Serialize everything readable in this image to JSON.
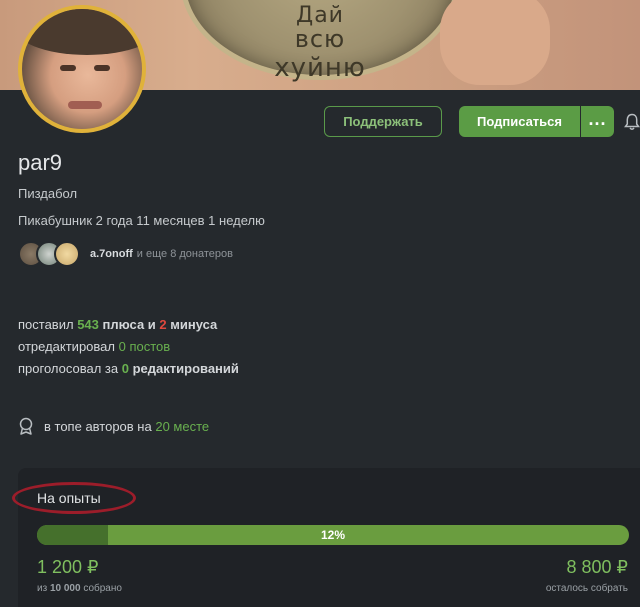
{
  "banner": {
    "coin_text": [
      "Дай",
      "всю",
      "хуйню"
    ]
  },
  "actions": {
    "support_label": "Поддержать",
    "subscribe_label": "Подписаться"
  },
  "profile": {
    "username": "par9",
    "status": "Пиздабол",
    "since": "Пикабушник 2 года 11 месяцев 1 неделю"
  },
  "donors": {
    "top_donor": "a.7onoff",
    "more_text": "и еще 8 донатеров"
  },
  "stats": {
    "pluses_prefix": "поставил",
    "pluses": "543",
    "pluses_word": "плюса и",
    "minuses": "2",
    "minuses_word": "минуса",
    "edited_prefix": "отредактировал",
    "edited_value": "0 постов",
    "voted_prefix": "проголосовал за",
    "voted_value": "0",
    "voted_word": "редактирований"
  },
  "rank": {
    "prefix": "в топе авторов на",
    "value": "20 месте"
  },
  "goal": {
    "title": "На опыты",
    "progress_percent": 12,
    "progress_label": "12%",
    "collected": "1 200 ₽",
    "collected_prefix": "из",
    "collected_total": "10 000",
    "collected_suffix": "собрано",
    "remaining": "8 800 ₽",
    "remaining_sub": "осталось собрать"
  },
  "colors": {
    "accent": "#5b9c45",
    "minus": "#e0483e",
    "goal_circle": "#9c1d2a",
    "avatar_ring": "#e0b23a"
  }
}
